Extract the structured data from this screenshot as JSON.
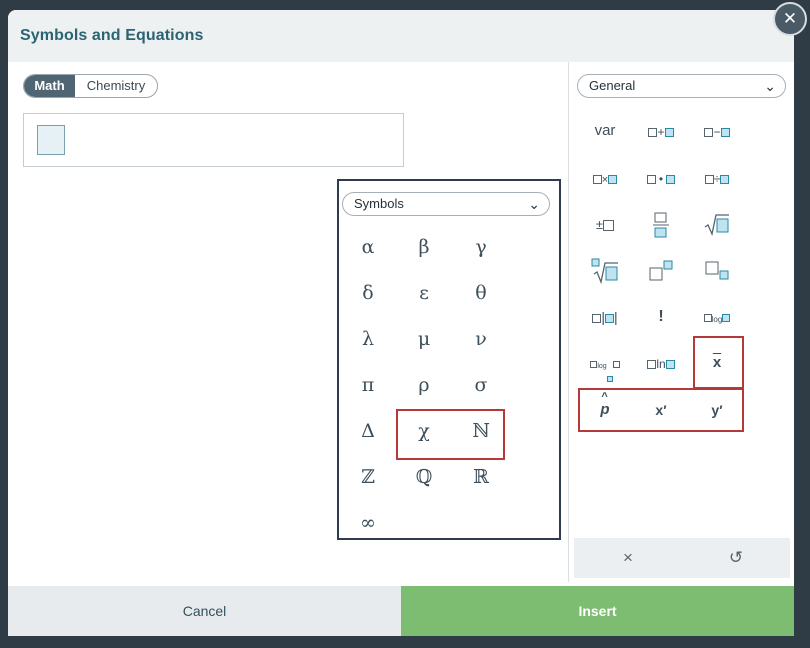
{
  "dialog": {
    "title": "Symbols and Equations",
    "close_label": "✕"
  },
  "mode_toggle": {
    "math_label": "Math",
    "chemistry_label": "Chemistry"
  },
  "symbols_dropdown": {
    "selected": "Symbols"
  },
  "symbols": [
    "α",
    "β",
    "γ",
    "δ",
    "ε",
    "θ",
    "λ",
    "μ",
    "ν",
    "π",
    "ρ",
    "σ",
    "Δ",
    "χ",
    "ℕ",
    "ℤ",
    "ℚ",
    "ℝ",
    "∞"
  ],
  "general_dropdown": {
    "selected": "General"
  },
  "general": {
    "var_label": "var",
    "factorial_label": "!",
    "ln_label": "ln",
    "log_label": "log",
    "xbar_label": "x",
    "phat_label": "p",
    "xprime_label": "x′",
    "yprime_label": "y′"
  },
  "tools": {
    "clear_icon": "×",
    "undo_icon": "↺"
  },
  "footer": {
    "cancel_label": "Cancel",
    "insert_label": "Insert"
  },
  "colors": {
    "accent": "#2c6373",
    "insert": "#7dbd71",
    "highlight": "#b43a3a"
  }
}
